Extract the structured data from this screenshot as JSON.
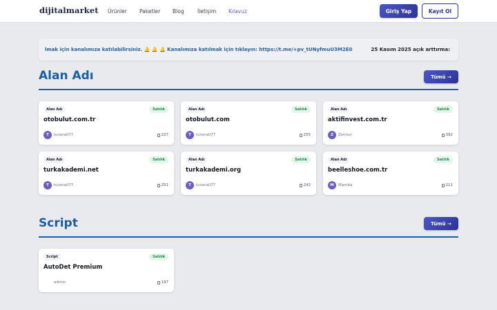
{
  "nav": {
    "logo": "dijitalmarket",
    "links": [
      {
        "label": "Ürünler",
        "active": false
      },
      {
        "label": "Paketler",
        "active": false
      },
      {
        "label": "Blog",
        "active": false
      },
      {
        "label": "İletişim",
        "active": false
      },
      {
        "label": "Kılavuz",
        "active": true
      }
    ],
    "login_label": "Giriş Yap",
    "register_label": "Kayıt Ol"
  },
  "announcement": {
    "marquee_text": "lmak için kanalımıza katılabilirsiniz. 🔔 🔔 🔔 Kanalımıza katılmak için tıklayın: https://t.me/+pv_tUNyfmuU3M2E0",
    "right_text": "25 Kasım 2025 açık arttırma:"
  },
  "sections": [
    {
      "title": "Alan Adı",
      "all_label": "Tümü →",
      "cards": [
        {
          "category": "Alan Adı",
          "status": "Satılık",
          "title": "otobulut.com.tr",
          "seller_initial": "T",
          "seller": "turanali77",
          "views": "227"
        },
        {
          "category": "Alan Adı",
          "status": "Satılık",
          "title": "otobulut.com",
          "seller_initial": "T",
          "seller": "turanali77",
          "views": "255"
        },
        {
          "category": "Alan Adı",
          "status": "Satılık",
          "title": "aktifinvest.com.tr",
          "seller_initial": "Z",
          "seller": "Zennur",
          "views": "392"
        },
        {
          "category": "Alan Adı",
          "status": "Satılık",
          "title": "turkakademi.net",
          "seller_initial": "T",
          "seller": "turanali77",
          "views": "251"
        },
        {
          "category": "Alan Adı",
          "status": "Satılık",
          "title": "turkakademi.org",
          "seller_initial": "T",
          "seller": "turanali77",
          "views": "243"
        },
        {
          "category": "Alan Adı",
          "status": "Satılık",
          "title": "beelleshoe.com.tr",
          "seller_initial": "M",
          "seller": "Mamba",
          "views": "211"
        }
      ]
    },
    {
      "title": "Script",
      "all_label": "Tümü →",
      "cards": [
        {
          "category": "Script",
          "status": "Satılık",
          "title": "AutoDet Premium",
          "seller_initial": "",
          "seller": "admin",
          "views": "197"
        }
      ]
    }
  ],
  "icons": {
    "view_count": "eye-icon",
    "arrow": "arrow-right-icon"
  },
  "colors": {
    "accent": "#2d3394",
    "section_title": "#1a5fa3",
    "status_green": "#1f8a4c",
    "avatar": "#6b5fc3"
  }
}
